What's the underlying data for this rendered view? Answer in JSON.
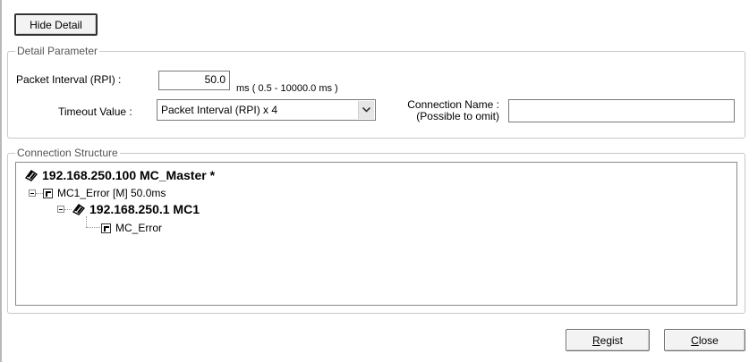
{
  "hide_detail_button": "Hide Detail",
  "detail_parameter": {
    "title": "Detail Parameter",
    "packet_interval_label": "Packet Interval (RPI) :",
    "packet_interval_value": "50.0",
    "packet_interval_range": "ms ( 0.5 - 10000.0 ms )",
    "timeout_label": "Timeout Value :",
    "timeout_selected": "Packet Interval (RPI) x 4",
    "connection_name_label_1": "Connection Name :",
    "connection_name_label_2": "(Possible to omit)",
    "connection_name_value": ""
  },
  "connection_structure": {
    "title": "Connection Structure",
    "root": "192.168.250.100 MC_Master *",
    "connection": "MC1_Error [M] 50.0ms",
    "target": "192.168.250.1 MC1",
    "tag": "MC_Error"
  },
  "buttons": {
    "regist_first": "R",
    "regist_rest": "egist",
    "close_first": "C",
    "close_rest": "lose"
  }
}
